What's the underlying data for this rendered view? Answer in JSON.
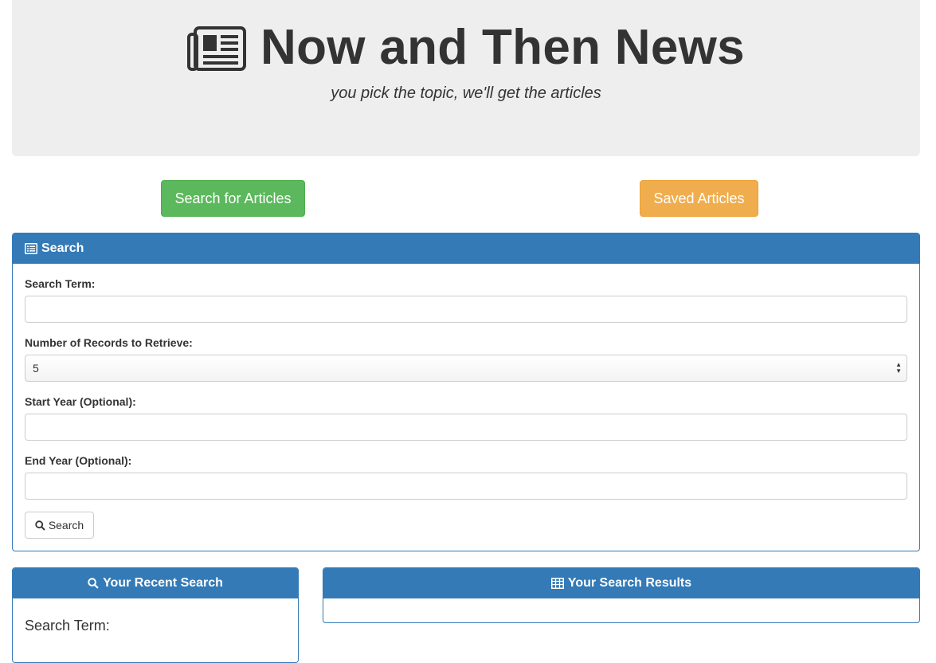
{
  "header": {
    "title": "Now and Then News",
    "subtitle": "you pick the topic, we'll get the articles",
    "icon": "newspaper-icon"
  },
  "nav": {
    "search_articles_label": "Search for Articles",
    "saved_articles_label": "Saved Articles"
  },
  "search_panel": {
    "heading": "Search",
    "heading_icon": "list-alt-icon",
    "search_term_label": "Search Term:",
    "search_term_value": "",
    "records_label": "Number of Records to Retrieve:",
    "records_value": "5",
    "start_year_label": "Start Year (Optional):",
    "start_year_value": "",
    "end_year_label": "End Year (Optional):",
    "end_year_value": "",
    "search_button_label": "Search",
    "search_button_icon": "search-icon"
  },
  "recent_panel": {
    "heading": "Your Recent Search",
    "heading_icon": "search-icon",
    "search_term_label": "Search Term:"
  },
  "results_panel": {
    "heading": "Your Search Results",
    "heading_icon": "table-icon"
  },
  "colors": {
    "primary": "#337ab7",
    "success": "#5cb85c",
    "warning": "#f0ad4e",
    "jumbotron": "#eeeeee"
  }
}
